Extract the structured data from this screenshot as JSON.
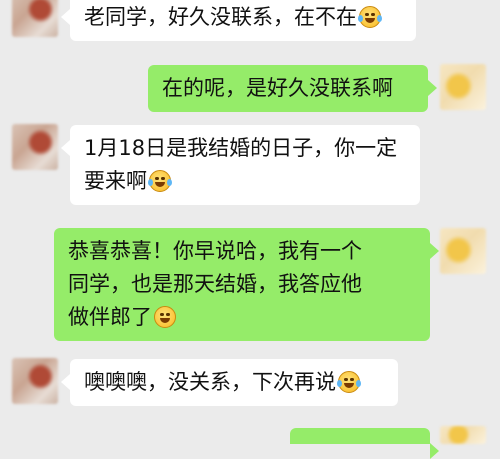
{
  "messages": [
    {
      "side": "in",
      "lines": [
        "老同学，好久没联系，在不在"
      ],
      "emoji": "laugh-cry-emoji"
    },
    {
      "side": "out",
      "lines": [
        "在的呢，是好久没联系啊"
      ],
      "emoji": ""
    },
    {
      "side": "in",
      "lines": [
        "1月18日是我结婚的日子，你一定",
        "要来啊"
      ],
      "emoji": "laugh-cry-emoji"
    },
    {
      "side": "out",
      "lines": [
        "恭喜恭喜！你早说哈，我有一个",
        "同学，也是那天结婚，我答应他",
        "做伴郎了"
      ],
      "emoji": "smile-emoji"
    },
    {
      "side": "in",
      "lines": [
        "噢噢噢，没关系，下次再说"
      ],
      "emoji": "laugh-cry-emoji"
    },
    {
      "side": "out",
      "lines": [
        ""
      ],
      "emoji": ""
    }
  ],
  "colors": {
    "background": "#ebebeb",
    "incoming_bubble": "#ffffff",
    "outgoing_bubble": "#95ec69"
  }
}
